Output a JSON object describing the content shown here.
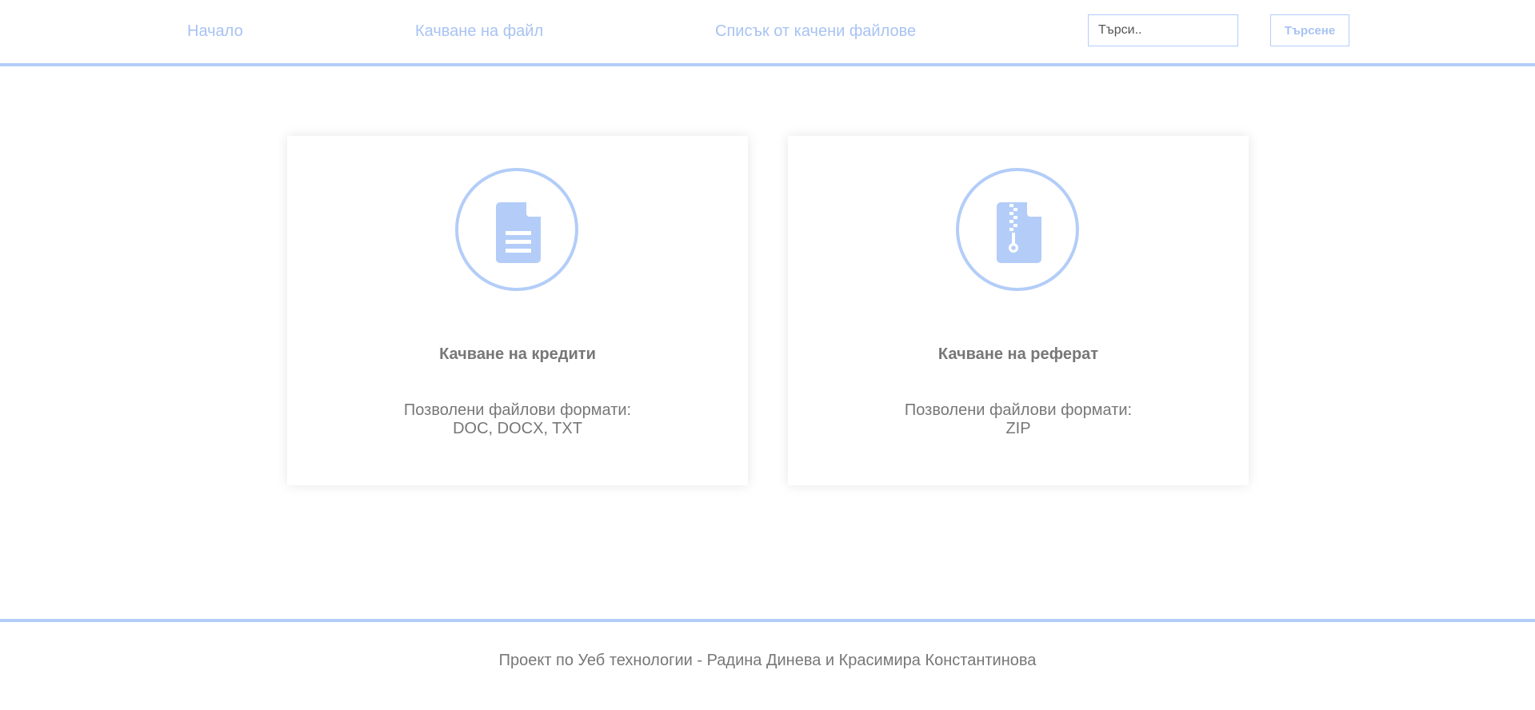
{
  "nav": {
    "home_label": "Начало",
    "upload_label": "Качване на файл",
    "list_label": "Списък от качени файлове"
  },
  "search": {
    "placeholder": "Търси..",
    "button_label": "Търсене"
  },
  "cards": [
    {
      "icon": "document-icon",
      "title": "Качване на кредити",
      "formats_label": "Позволени файлови формати:",
      "formats": "DOC, DOCX, TXT"
    },
    {
      "icon": "zip-file-icon",
      "title": "Качване на реферат",
      "formats_label": "Позволени файлови формати:",
      "formats": "ZIP"
    }
  ],
  "footer": {
    "text": "Проект по Уеб технологии - Радина Динева и Красимира Константинова"
  },
  "colors": {
    "accent": "#b3cdf8",
    "nav_text": "#a8c3f2",
    "body_text": "#777777"
  }
}
